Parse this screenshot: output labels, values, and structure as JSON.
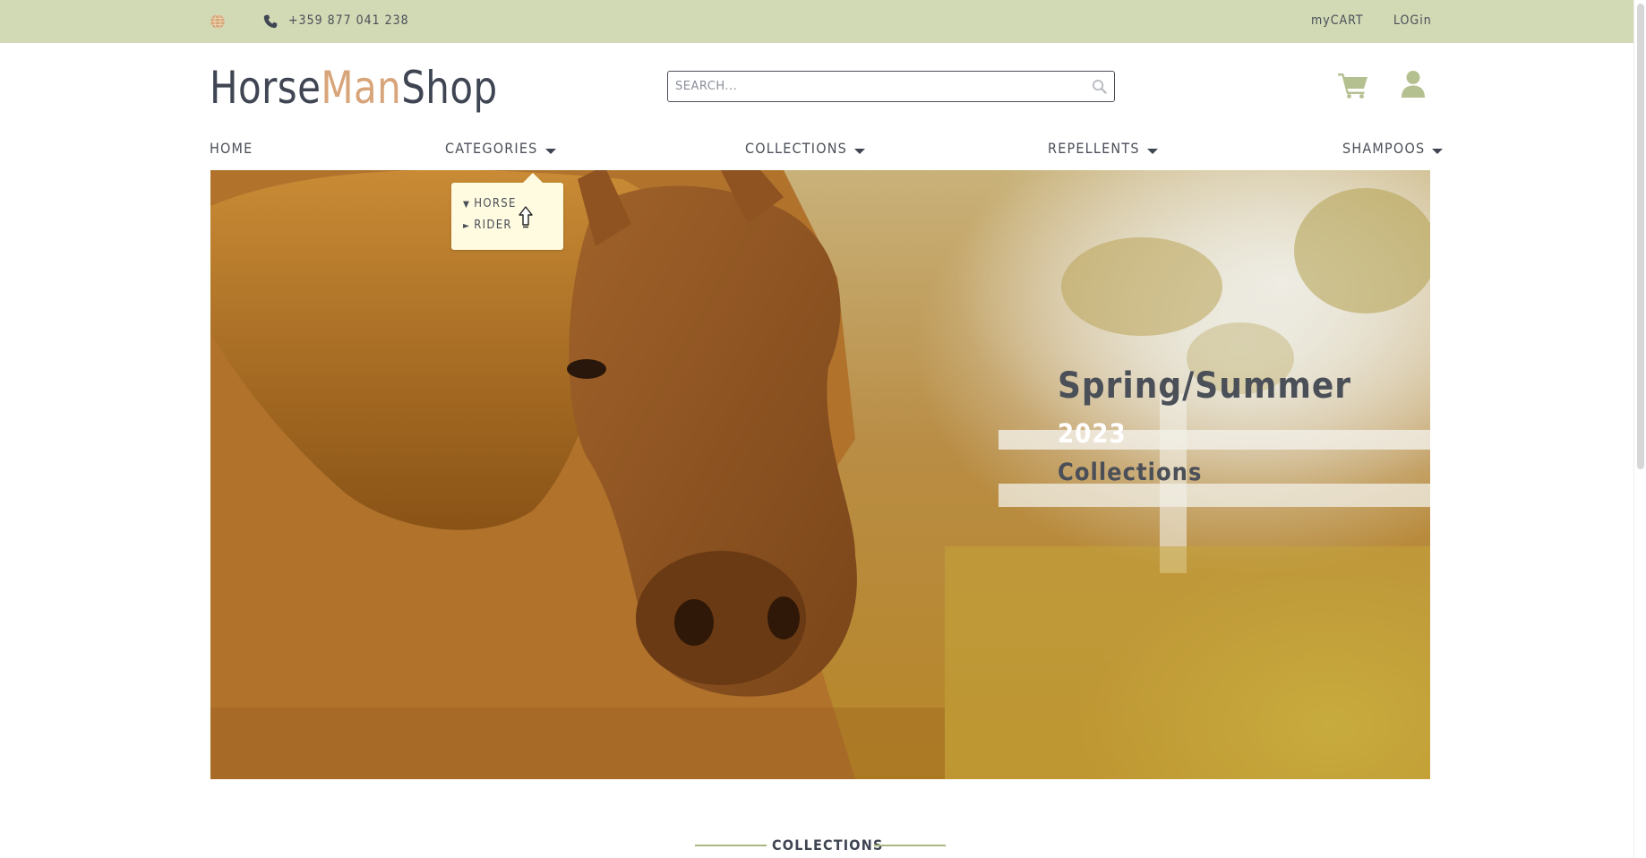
{
  "topbar": {
    "phone": "+359 877 041 238",
    "cart_link": "myCART",
    "login_link": "LOGin",
    "icons": [
      "globe-icon",
      "phone-icon"
    ]
  },
  "header": {
    "logo_part1": "Horse",
    "logo_part2": "Man",
    "logo_part3": "Shop",
    "search_placeholder": "SEARCH...",
    "icons": [
      "search-icon",
      "cart-icon",
      "user-icon"
    ]
  },
  "nav": {
    "home": "HOME",
    "categories": "CATEGORIES",
    "collections": "COLLECTIONS",
    "repellents": "REPELLENTS",
    "shampoos": "SHAMPOOS"
  },
  "dropdown": {
    "items": [
      {
        "marker": "▼",
        "label": "HORSE"
      },
      {
        "marker": "►",
        "label": "RIDER"
      }
    ]
  },
  "hero": {
    "title": "Spring/Summer",
    "year": "2023",
    "subtitle": "Collections"
  },
  "section": {
    "heading": "COLLECTIONS"
  },
  "colors": {
    "topbar_bg": "#d1d9b5",
    "text_dark": "#4b4f58",
    "logo_accent": "#d8a479",
    "icon_green": "#b5c090",
    "dropdown_bg": "#fffbe0"
  }
}
